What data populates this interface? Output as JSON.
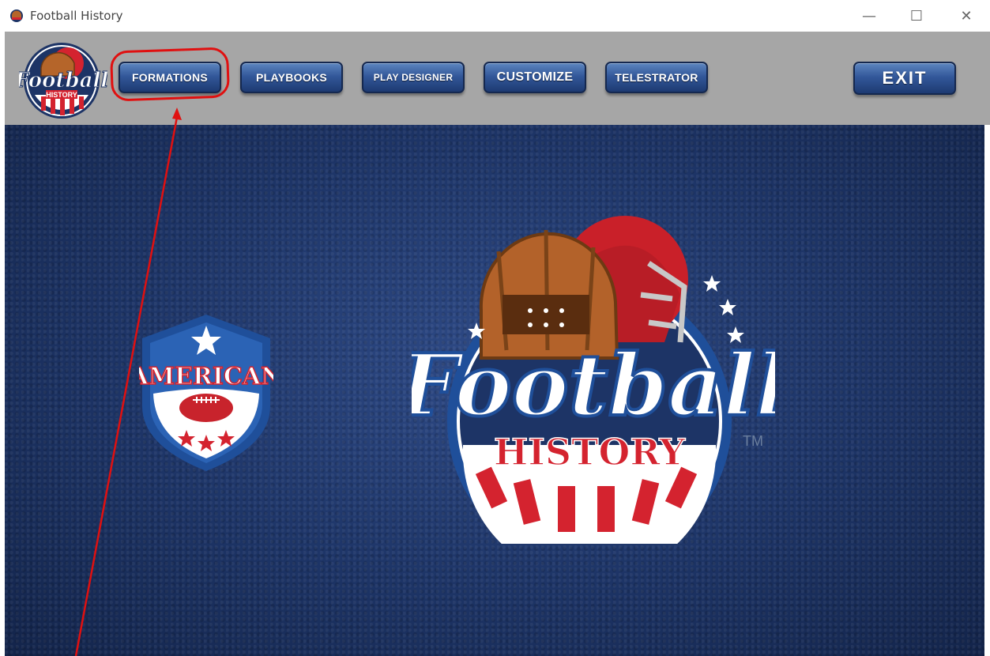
{
  "window": {
    "title": "Football History",
    "minimize_glyph": "—",
    "maximize_glyph": "☐",
    "close_glyph": "✕"
  },
  "toolbar": {
    "buttons": [
      {
        "label": "FORMATIONS"
      },
      {
        "label": "PLAYBOOKS"
      },
      {
        "label": "PLAY DESIGNER"
      },
      {
        "label": "CUSTOMIZE"
      },
      {
        "label": "TELESTRATOR"
      }
    ],
    "exit_label": "EXIT"
  },
  "main": {
    "badge_text": "AMERICAN",
    "logo_title": "Football",
    "logo_subtitle": "HISTORY",
    "trademark": "TM",
    "small_logo_title": "Football",
    "small_logo_subtitle": "HISTORY"
  },
  "colors": {
    "toolbar_bg": "#a6a6a6",
    "button_blue": "#2f5597",
    "background_navy": "#1d3466",
    "annotation_red": "#e01010",
    "logo_red": "#d4232f"
  },
  "icons": {
    "app_icon": "football-helmet-icon"
  }
}
